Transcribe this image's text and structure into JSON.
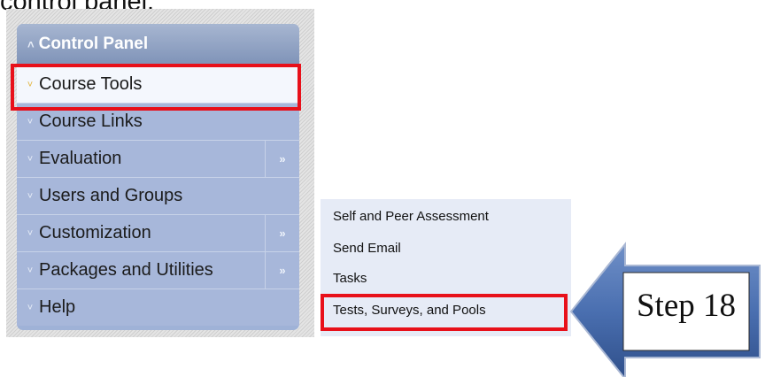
{
  "doc_caption": "control panel.",
  "control_panel": {
    "title": "Control Panel",
    "items": [
      {
        "label": "Course Tools",
        "active": true,
        "has_arrow": false
      },
      {
        "label": "Course Links",
        "active": false,
        "has_arrow": false
      },
      {
        "label": "Evaluation",
        "active": false,
        "has_arrow": true
      },
      {
        "label": "Users and Groups",
        "active": false,
        "has_arrow": false
      },
      {
        "label": "Customization",
        "active": false,
        "has_arrow": true
      },
      {
        "label": "Packages and Utilities",
        "active": false,
        "has_arrow": true
      },
      {
        "label": "Help",
        "active": false,
        "has_arrow": false
      }
    ]
  },
  "submenu": {
    "items": [
      {
        "label": "Self and Peer Assessment"
      },
      {
        "label": "Send Email"
      },
      {
        "label": "Tasks"
      },
      {
        "label": "Tests, Surveys, and Pools"
      }
    ]
  },
  "callout": {
    "label": "Step 18"
  },
  "colors": {
    "highlight": "#e8101a",
    "panel_header": "#7f93b8",
    "panel_item": "#a7b7da",
    "submenu_bg": "#e6ebf6",
    "arrow_fill": "#4a6fb0"
  }
}
